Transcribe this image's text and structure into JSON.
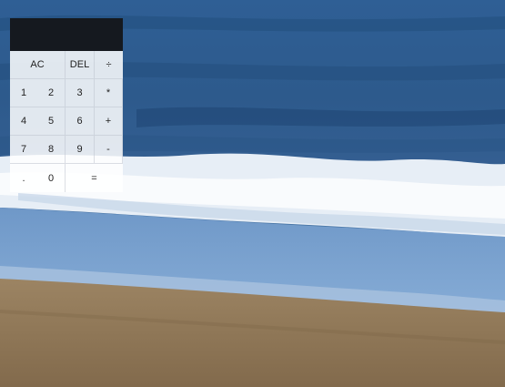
{
  "calculator": {
    "display": "",
    "keys": {
      "ac": "AC",
      "del": "DEL",
      "divide": "÷",
      "seven": "7",
      "eight": "8",
      "nine": "9",
      "multiply": "*",
      "four": "4",
      "five": "5",
      "six": "6",
      "plus": "+",
      "one": "1",
      "two": "2",
      "three": "3",
      "minus": "-",
      "dot": ".",
      "zero": "0",
      "equals": "="
    }
  }
}
